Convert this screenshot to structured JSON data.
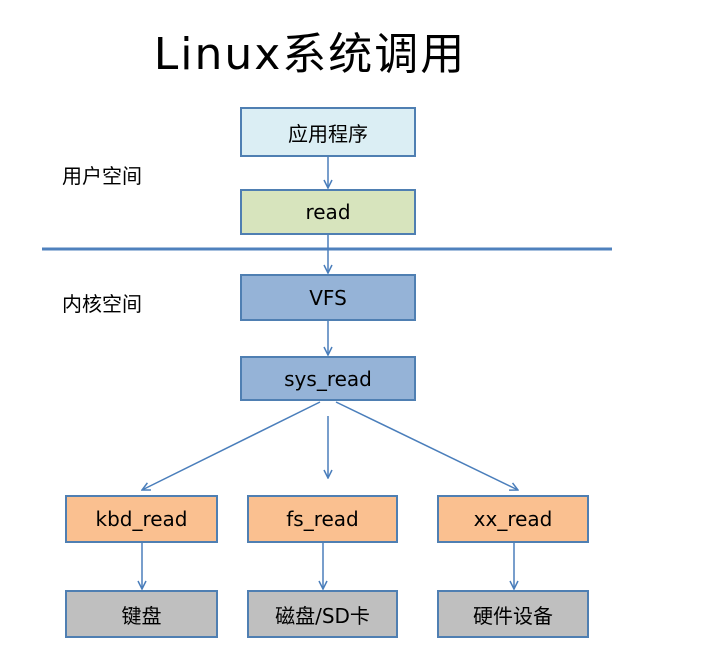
{
  "title": "Linux系统调用",
  "regions": {
    "user_space": "用户空间",
    "kernel_space": "内核空间"
  },
  "nodes": {
    "app": "应用程序",
    "read": "read",
    "vfs": "VFS",
    "sys_read": "sys_read",
    "kbd_read": "kbd_read",
    "fs_read": "fs_read",
    "xx_read": "xx_read",
    "keyboard": "键盘",
    "disk_sd": "磁盘/SD卡",
    "hardware": "硬件设备"
  },
  "colors": {
    "app_fill": "#dbeef4",
    "read_fill": "#d7e4bd",
    "kernel_fill": "#95b3d7",
    "driver_fill": "#fac090",
    "device_fill": "#bfbfbf",
    "border": "#4f7fb2",
    "divider": "#4f81bd",
    "arrow": "#4a7ebb"
  }
}
